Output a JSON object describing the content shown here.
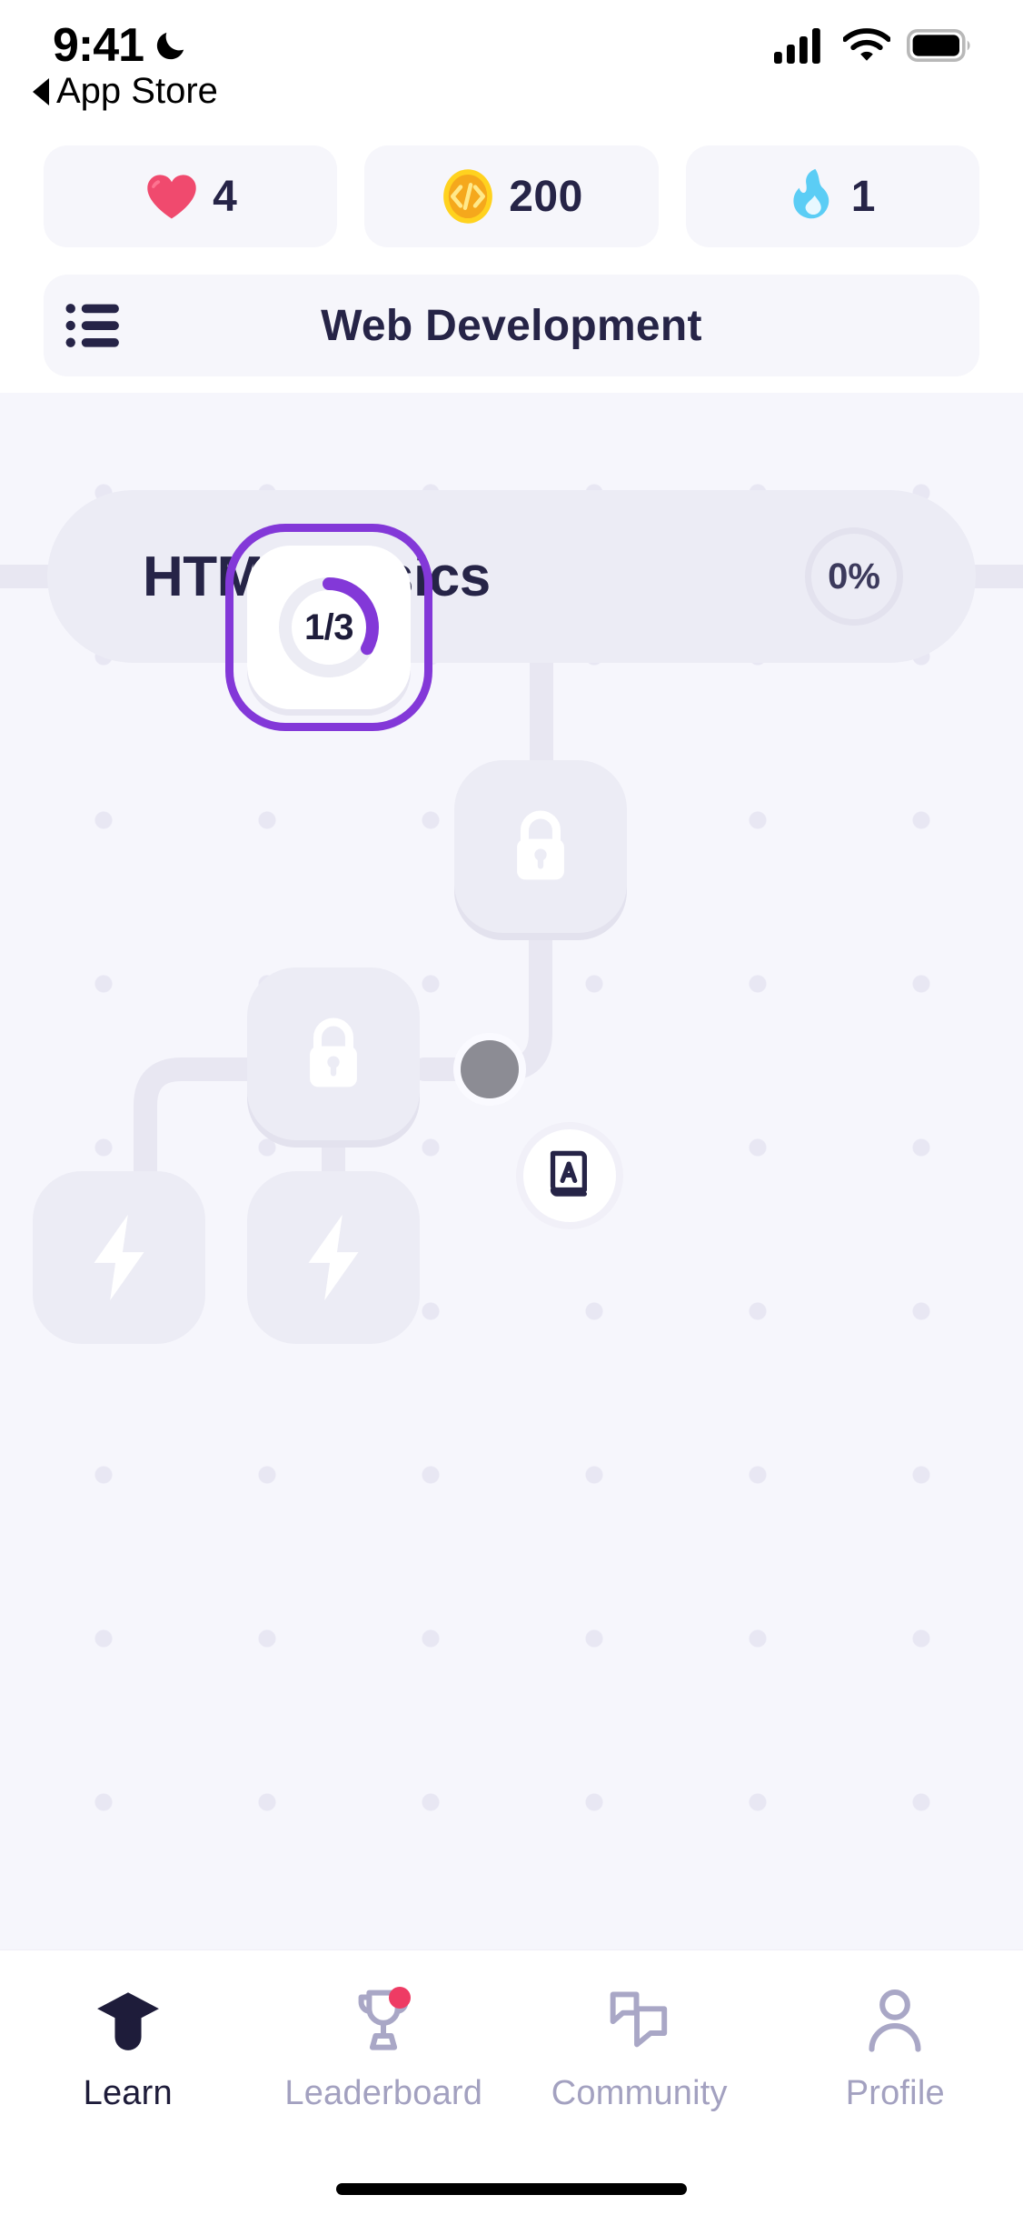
{
  "status_bar": {
    "time": "9:41",
    "moon_icon": "moon-icon",
    "signal_icon": "cellular-signal-icon",
    "wifi_icon": "wifi-icon",
    "battery_icon": "battery-full-icon"
  },
  "back_nav": {
    "icon": "back-triangle-icon",
    "label": "App Store"
  },
  "header": {
    "stats": [
      {
        "icon": "heart-icon",
        "value": "4",
        "color": "#f04a6e",
        "name": "lives"
      },
      {
        "icon": "coin-code-icon",
        "value": "200",
        "color": "#ffc41f",
        "name": "coins"
      },
      {
        "icon": "flame-icon",
        "value": "1",
        "color": "#5bcdf5",
        "name": "streak"
      }
    ],
    "course": {
      "menu_icon": "list-menu-icon",
      "title": "Web Development"
    }
  },
  "map": {
    "unit": {
      "title": "HTML Basics",
      "progress_label": "0%",
      "progress_pct": 0
    },
    "nodes": [
      {
        "name": "lesson-node-active",
        "state": "active",
        "label": "1/3",
        "progress_pct": 33,
        "accent": "#8338d8"
      },
      {
        "name": "lesson-node-locked-1",
        "state": "locked",
        "icon": "lock-icon"
      },
      {
        "name": "lesson-node-locked-2",
        "state": "locked",
        "icon": "lock-icon"
      },
      {
        "name": "lesson-node-bolt-1",
        "state": "locked",
        "icon": "bolt-icon"
      },
      {
        "name": "lesson-node-bolt-2",
        "state": "locked",
        "icon": "bolt-icon"
      },
      {
        "name": "path-marker-dot",
        "state": "marker",
        "color": "#8c8c94"
      }
    ],
    "dictionary_fab": {
      "icon": "dictionary-book-icon",
      "name": "dictionary-button"
    }
  },
  "bottom_nav": {
    "items": [
      {
        "label": "Learn",
        "icon": "graduation-cap-icon",
        "active": true,
        "badge": false
      },
      {
        "label": "Leaderboard",
        "icon": "trophy-icon",
        "active": false,
        "badge": true
      },
      {
        "label": "Community",
        "icon": "chat-bubbles-icon",
        "active": false,
        "badge": false
      },
      {
        "label": "Profile",
        "icon": "person-icon",
        "active": false,
        "badge": false
      }
    ]
  },
  "colors": {
    "accent": "#8338d8",
    "text_dark": "#262447",
    "text_muted": "#a3a1c0",
    "map_bg": "#f6f6fc",
    "chip_bg": "#f6f6fb",
    "node_locked": "#ececf5",
    "badge": "#ee3b64"
  }
}
